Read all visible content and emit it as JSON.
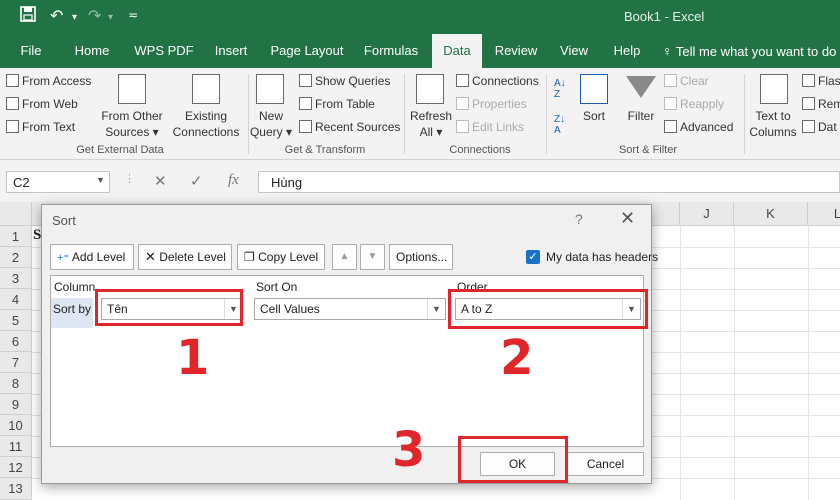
{
  "window": {
    "title": "Book1  -  Excel"
  },
  "quick_access": {
    "save_icon": "save-icon",
    "undo_icon": "undo-icon",
    "redo_icon": "redo-icon",
    "customize_icon": "customize-icon"
  },
  "tabs": [
    "File",
    "Home",
    "WPS PDF",
    "Insert",
    "Page Layout",
    "Formulas",
    "Data",
    "Review",
    "View",
    "Help"
  ],
  "active_tab": "Data",
  "tell_me": "Tell me what you want to do",
  "ribbon": {
    "get_external": {
      "from_access": "From Access",
      "from_web": "From Web",
      "from_text": "From Text",
      "from_other_1": "From Other",
      "from_other_2": "Sources",
      "existing_1": "Existing",
      "existing_2": "Connections",
      "label": "Get External Data"
    },
    "get_transform": {
      "new_query_1": "New",
      "new_query_2": "Query",
      "show_queries": "Show Queries",
      "from_table": "From Table",
      "recent_sources": "Recent Sources",
      "label": "Get & Transform"
    },
    "connections": {
      "refresh_1": "Refresh",
      "refresh_2": "All",
      "connections": "Connections",
      "properties": "Properties",
      "edit_links": "Edit Links",
      "label": "Connections"
    },
    "sort_filter": {
      "sort": "Sort",
      "filter": "Filter",
      "clear": "Clear",
      "reapply": "Reapply",
      "advanced": "Advanced",
      "label": "Sort & Filter"
    },
    "data_tools": {
      "text_to_1": "Text to",
      "text_to_2": "Columns",
      "flash": "Flas",
      "remove": "Rem",
      "validate": "Dat"
    }
  },
  "formula_bar": {
    "name_box": "C2",
    "cancel": "✕",
    "enter": "✓",
    "fx": "fx",
    "value": "Hùng"
  },
  "grid": {
    "visible_columns": [
      "J",
      "K",
      "L"
    ],
    "rows": [
      "1",
      "2",
      "3",
      "4",
      "5",
      "6",
      "7",
      "8",
      "9",
      "10",
      "11",
      "12",
      "13"
    ],
    "a1_fragment": "S"
  },
  "dialog": {
    "title": "Sort",
    "help": "?",
    "add_level": "Add Level",
    "delete_level": "Delete Level",
    "copy_level": "Copy Level",
    "options": "Options...",
    "headers_checkbox": "My data has headers",
    "headers_checked": true,
    "col_header": "Column",
    "sorton_header": "Sort On",
    "order_header": "Order",
    "sort_by": "Sort by",
    "column_value": "Tên",
    "sorton_value": "Cell Values",
    "order_value": "A to Z",
    "ok": "OK",
    "cancel": "Cancel"
  },
  "annotations": {
    "one": "1",
    "two": "2",
    "three": "3",
    "color": "#e0262a"
  },
  "colors": {
    "excel_green": "#217346",
    "checkbox_blue": "#1a73c8"
  }
}
